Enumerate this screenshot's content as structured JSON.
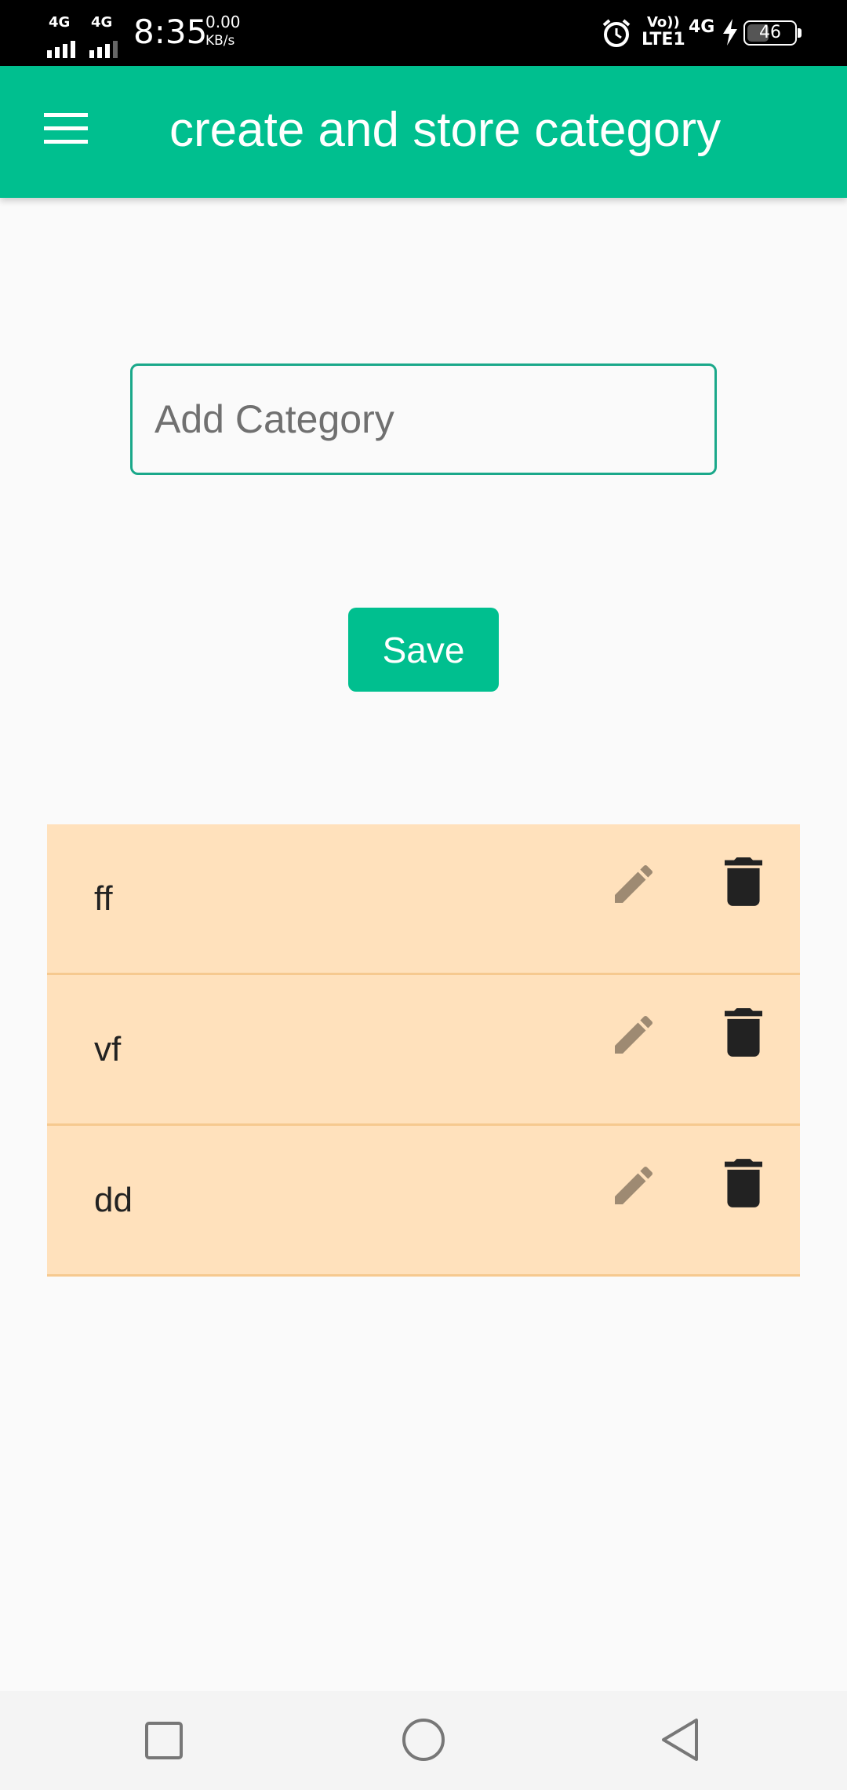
{
  "status_bar": {
    "sim1_network": "4G",
    "sim2_network": "4G",
    "time": "8:35",
    "speed_value": "0.00",
    "speed_unit": "KB/s",
    "volte_top": "Vo))",
    "volte_bottom": "LTE1",
    "network_right": "4G",
    "battery_level": "46",
    "battery_fraction": 0.46,
    "alarm_icon": "alarm-icon",
    "charging_icon": "bolt-icon"
  },
  "app_bar": {
    "title": "create and store category",
    "menu_icon": "hamburger-menu-icon",
    "color": "#00bf8f"
  },
  "form": {
    "input_placeholder": "Add Category",
    "input_value": "",
    "save_label": "Save",
    "accent": "#1aa88a"
  },
  "categories": {
    "items": [
      {
        "label": "ff"
      },
      {
        "label": "vf"
      },
      {
        "label": "dd"
      }
    ],
    "background": "#ffe1bc",
    "edit_icon": "pencil-icon",
    "delete_icon": "trash-icon"
  },
  "nav_bar": {
    "recents_icon": "square-icon",
    "home_icon": "circle-icon",
    "back_icon": "triangle-back-icon"
  }
}
